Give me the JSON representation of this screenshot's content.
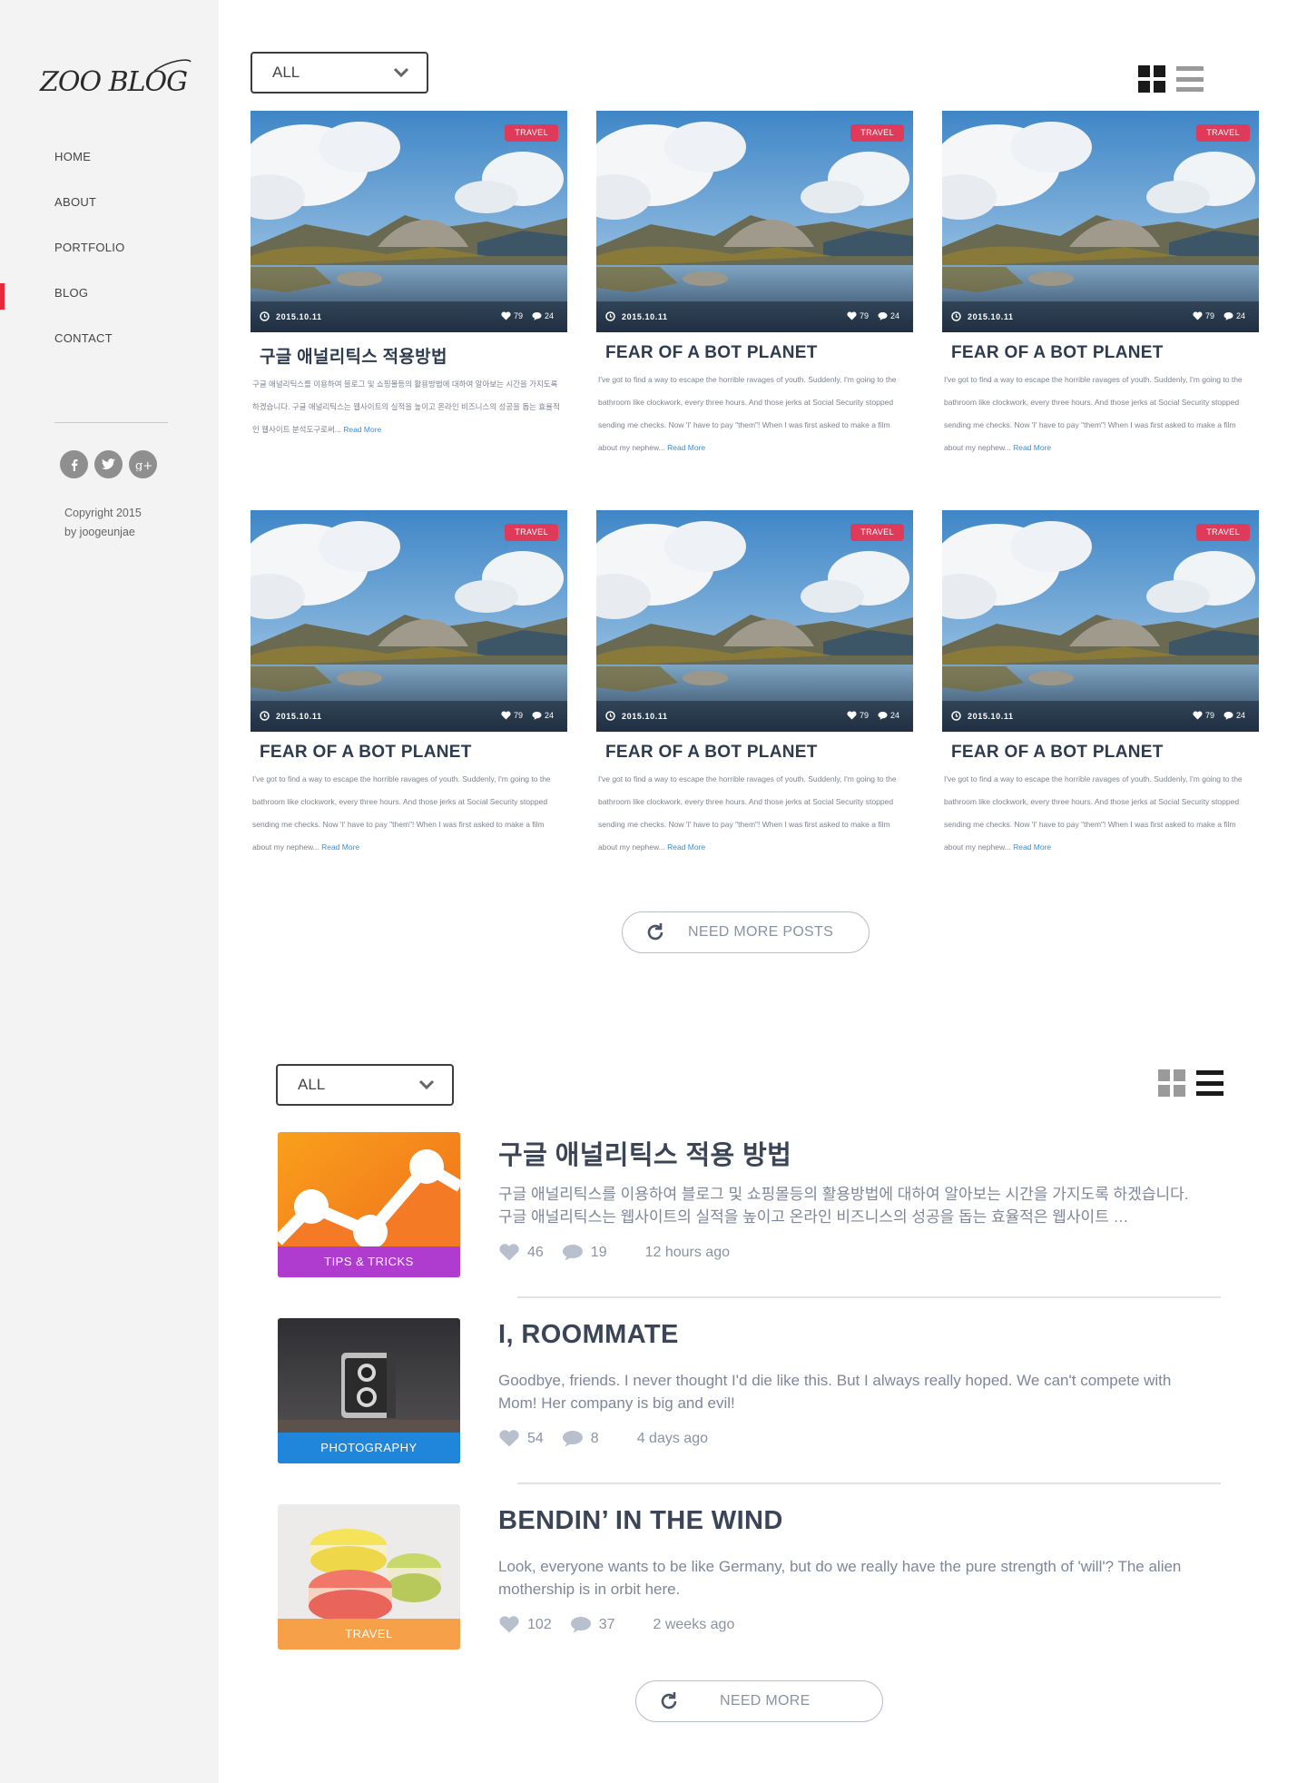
{
  "brand": {
    "logo_text": "ZOO BLOG"
  },
  "nav": [
    {
      "label": "HOME",
      "active": false
    },
    {
      "label": "ABOUT",
      "active": false
    },
    {
      "label": "PORTFOLIO",
      "active": false
    },
    {
      "label": "BLOG",
      "active": true
    },
    {
      "label": "CONTACT",
      "active": false
    }
  ],
  "socials": [
    "facebook-icon",
    "twitter-icon",
    "google-plus-icon"
  ],
  "copyright": {
    "line1": "Copyright 2015",
    "line2": "by joogeunjae"
  },
  "colors": {
    "accent": "#e8273a",
    "tag_travel": "#e03a5a",
    "link": "#3a8fd9",
    "dark": "#1a1a1a",
    "muted_icon": "#8f8f8f"
  },
  "grid_section": {
    "filter": {
      "selected": "ALL"
    },
    "view": "grid",
    "cards": [
      {
        "tag": "TRAVEL",
        "date": "2015.10.11",
        "likes": "79",
        "comments": "24",
        "title": "구글 애널리틱스 적용방법",
        "excerpt": "구글 애널리틱스를 이용하여 블로그 및 쇼핑몰등의 활용방법에 대하여 알아보는 시간을 가지도록 하겠습니다. 구글 애널리틱스는 웹사이트의 실적을 높이고 온라인 비즈니스의 성공을 돕는 효율적인 웹사이트 분석도구로써...",
        "read_more": "Read More"
      },
      {
        "tag": "TRAVEL",
        "date": "2015.10.11",
        "likes": "79",
        "comments": "24",
        "title": "FEAR OF A BOT PLANET",
        "excerpt": "I've got to find a way to escape the horrible ravages of youth. Suddenly, I'm going to the bathroom like clockwork, every three hours. And those jerks at Social Security stopped sending me checks. Now 'I' have to pay \"them\"! When I was first asked to make a film about my nephew...",
        "read_more": "Read More"
      },
      {
        "tag": "TRAVEL",
        "date": "2015.10.11",
        "likes": "79",
        "comments": "24",
        "title": "FEAR OF A BOT PLANET",
        "excerpt": "I've got to find a way to escape the horrible ravages of youth. Suddenly, I'm going to the bathroom like clockwork, every three hours. And those jerks at Social Security stopped sending me checks. Now 'I' have to pay \"them\"! When I was first asked to make a film about my nephew...",
        "read_more": "Read More"
      },
      {
        "tag": "TRAVEL",
        "date": "2015.10.11",
        "likes": "79",
        "comments": "24",
        "title": "FEAR OF A BOT PLANET",
        "excerpt": "I've got to find a way to escape the horrible ravages of youth. Suddenly, I'm going to the bathroom like clockwork, every three hours. And those jerks at Social Security stopped sending me checks. Now 'I' have to pay \"them\"! When I was first asked to make a film about my nephew...",
        "read_more": "Read More"
      },
      {
        "tag": "TRAVEL",
        "date": "2015.10.11",
        "likes": "79",
        "comments": "24",
        "title": "FEAR OF A BOT PLANET",
        "excerpt": "I've got to find a way to escape the horrible ravages of youth. Suddenly, I'm going to the bathroom like clockwork, every three hours. And those jerks at Social Security stopped sending me checks. Now 'I' have to pay \"them\"! When I was first asked to make a film about my nephew...",
        "read_more": "Read More"
      },
      {
        "tag": "TRAVEL",
        "date": "2015.10.11",
        "likes": "79",
        "comments": "24",
        "title": "FEAR OF A BOT PLANET",
        "excerpt": "I've got to find a way to escape the horrible ravages of youth. Suddenly, I'm going to the bathroom like clockwork, every three hours. And those jerks at Social Security stopped sending me checks. Now 'I' have to pay \"them\"! When I was first asked to make a film about my nephew...",
        "read_more": "Read More"
      }
    ],
    "load_more": "NEED MORE POSTS"
  },
  "list_section": {
    "filter": {
      "selected": "ALL"
    },
    "view": "list",
    "posts": [
      {
        "category": "TIPS & TRICKS",
        "category_color": "#b03ccf",
        "title": "구글 애널리틱스 적용 방법",
        "excerpt": "구글 애널리틱스를 이용하여 블로그 및 쇼핑몰등의 활용방법에 대하여 알아보는 시간을 가지도록 하겠습니다. 구글 애널리틱스는 웹사이트의 실적을 높이고 온라인 비즈니스의 성공을 돕는 효율적은 웹사이트 …",
        "likes": "46",
        "comments": "19",
        "time": "12 hours ago"
      },
      {
        "category": "PHOTOGRAPHY",
        "category_color": "#1f86db",
        "title": "I, ROOMMATE",
        "excerpt": "Goodbye, friends. I never thought I'd die like this. But I always really hoped. We can't compete with Mom! Her company is big and evil!",
        "likes": "54",
        "comments": "8",
        "time": "4 days ago"
      },
      {
        "category": "TRAVEL",
        "category_color": "#f7a04a",
        "title": "BENDIN’ IN THE WIND",
        "excerpt": "Look, everyone wants to be like Germany, but do we really have the pure strength of 'will'? The alien mothership is in orbit here.",
        "likes": "102",
        "comments": "37",
        "time": "2 weeks ago"
      }
    ],
    "load_more": "NEED MORE"
  }
}
